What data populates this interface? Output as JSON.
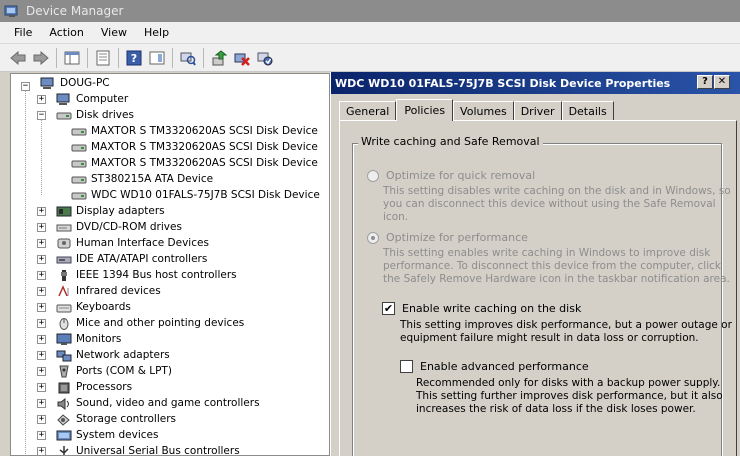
{
  "window": {
    "title": "Device Manager"
  },
  "menu": [
    "File",
    "Action",
    "View",
    "Help"
  ],
  "toolbar": {
    "icons": [
      "back-icon",
      "forward-icon",
      "show-hide-tree-icon",
      "properties-icon",
      "help-icon",
      "action-pane-icon",
      "scan-hardware-icon",
      "update-driver-icon",
      "uninstall-icon",
      "enable-device-icon"
    ]
  },
  "tree": {
    "root": "DOUG-PC",
    "categories": [
      {
        "label": "Computer",
        "expander": "+",
        "icon": "computer-icon"
      },
      {
        "label": "Disk drives",
        "expander": "−",
        "icon": "disk-icon",
        "children": [
          "MAXTOR S TM3320620AS SCSI Disk Device",
          "MAXTOR S TM3320620AS SCSI Disk Device",
          "MAXTOR S TM3320620AS SCSI Disk Device",
          "ST380215A ATA Device",
          "WDC WD10 01FALS-75J7B SCSI Disk Device"
        ]
      },
      {
        "label": "Display adapters",
        "expander": "+",
        "icon": "display-icon"
      },
      {
        "label": "DVD/CD-ROM drives",
        "expander": "+",
        "icon": "dvd-icon"
      },
      {
        "label": "Human Interface Devices",
        "expander": "+",
        "icon": "hid-icon"
      },
      {
        "label": "IDE ATA/ATAPI controllers",
        "expander": "+",
        "icon": "ide-icon"
      },
      {
        "label": "IEEE 1394 Bus host controllers",
        "expander": "+",
        "icon": "ieee1394-icon"
      },
      {
        "label": "Infrared devices",
        "expander": "+",
        "icon": "infrared-icon"
      },
      {
        "label": "Keyboards",
        "expander": "+",
        "icon": "keyboard-icon"
      },
      {
        "label": "Mice and other pointing devices",
        "expander": "+",
        "icon": "mouse-icon"
      },
      {
        "label": "Monitors",
        "expander": "+",
        "icon": "monitor-icon"
      },
      {
        "label": "Network adapters",
        "expander": "+",
        "icon": "network-icon"
      },
      {
        "label": "Ports (COM & LPT)",
        "expander": "+",
        "icon": "port-icon"
      },
      {
        "label": "Processors",
        "expander": "+",
        "icon": "processor-icon"
      },
      {
        "label": "Sound, video and game controllers",
        "expander": "+",
        "icon": "sound-icon"
      },
      {
        "label": "Storage controllers",
        "expander": "+",
        "icon": "storage-icon"
      },
      {
        "label": "System devices",
        "expander": "+",
        "icon": "system-icon"
      },
      {
        "label": "Universal Serial Bus controllers",
        "expander": "+",
        "icon": "usb-icon"
      }
    ]
  },
  "dialog": {
    "title": "WDC WD10 01FALS-75J7B SCSI Disk Device Properties",
    "help_btn": "?",
    "close_btn": "✕",
    "tabs": [
      "General",
      "Policies",
      "Volumes",
      "Driver",
      "Details"
    ],
    "active_tab": "Policies",
    "group_label": "Write caching and Safe Removal",
    "options": {
      "quick_removal": {
        "label": "Optimize for quick removal",
        "desc": [
          "This setting disables write caching on the disk and in Windows, so",
          "you can disconnect this device without using the Safe Removal",
          "icon."
        ],
        "selected": false,
        "enabled": false
      },
      "performance": {
        "label": "Optimize for performance",
        "desc": [
          "This setting enables write caching in Windows to improve disk",
          "performance. To disconnect this device from the computer, click",
          "the Safely Remove Hardware icon in the taskbar notification area."
        ],
        "selected": true,
        "enabled": false
      },
      "write_caching": {
        "label": "Enable write caching on the disk",
        "desc": [
          "This setting improves disk performance, but a power outage or",
          "equipment failure might result in data loss or corruption."
        ],
        "checked": true
      },
      "advanced": {
        "label": "Enable advanced performance",
        "desc": [
          "Recommended only for disks with a backup power supply.",
          "This setting further improves disk performance, but it also",
          "increases the risk of data loss if the disk loses power."
        ],
        "checked": false
      }
    },
    "check_mark": "✔"
  },
  "colors": {
    "titlebar": "#8c8c8c",
    "dialog_title": "#0a246a",
    "accent_blue": "#2a54a8"
  }
}
